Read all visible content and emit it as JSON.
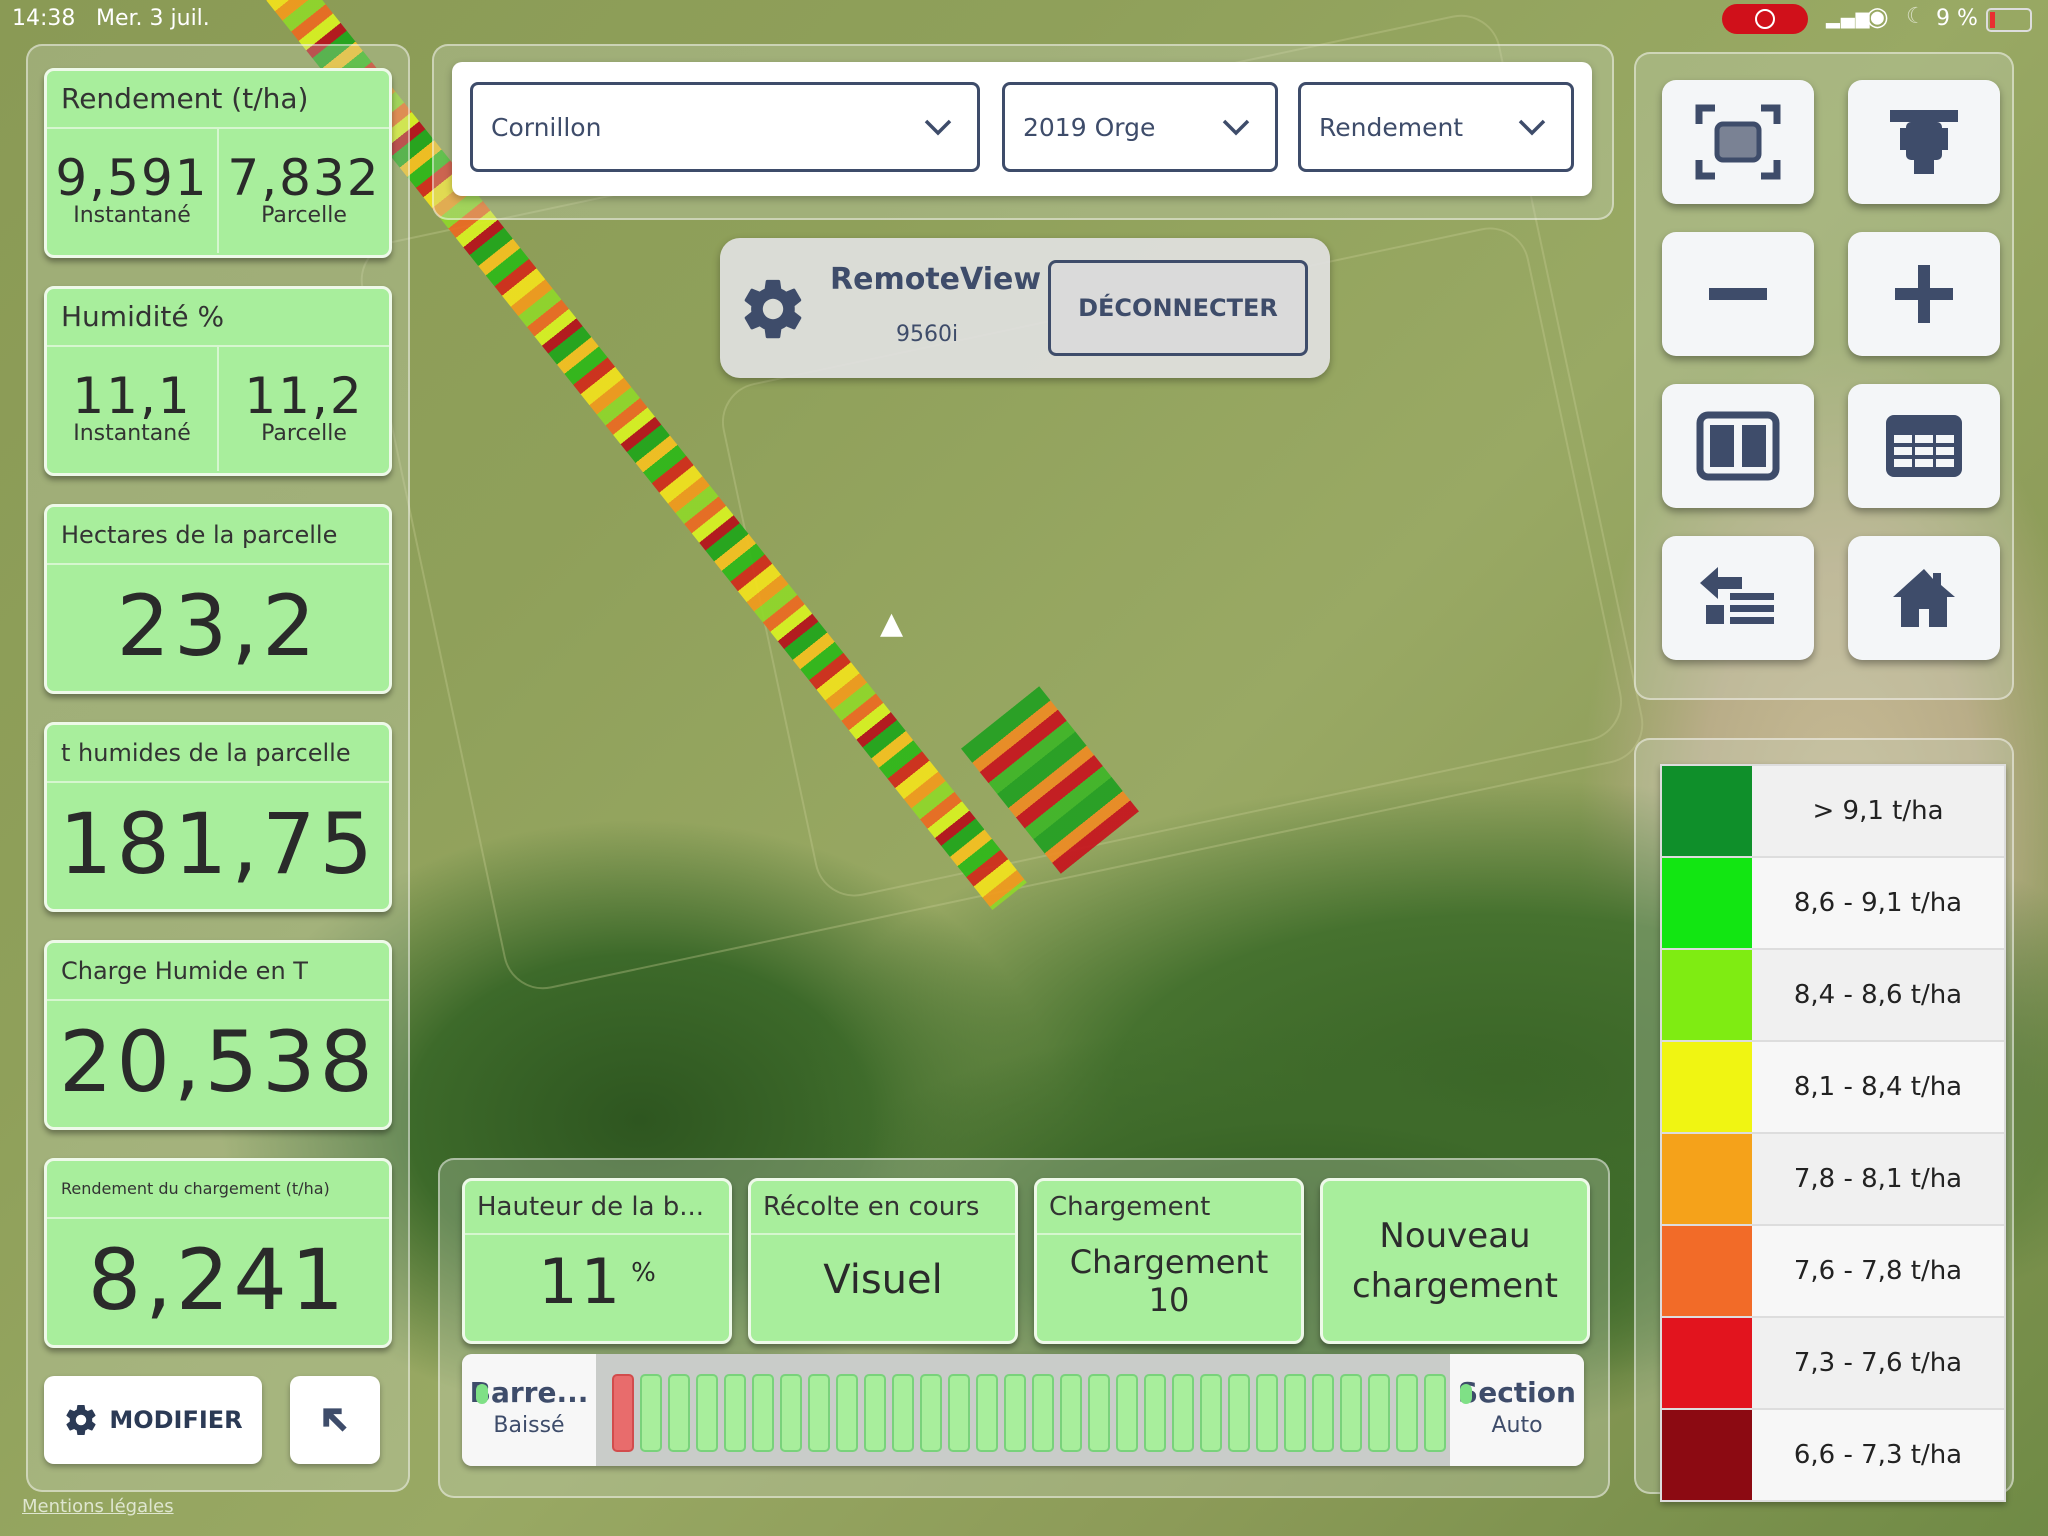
{
  "status_bar": {
    "time": "14:38",
    "date": "Mer. 3 juil.",
    "battery": "9 %"
  },
  "metrics": [
    {
      "title": "Rendement (t/ha)",
      "left_value": "9,591",
      "left_label": "Instantané",
      "right_value": "7,832",
      "right_label": "Parcelle"
    },
    {
      "title": "Humidité %",
      "left_value": "11,1",
      "left_label": "Instantané",
      "right_value": "11,2",
      "right_label": "Parcelle"
    }
  ],
  "single_metrics": [
    {
      "title": "Hectares de la parcelle",
      "value": "23,2"
    },
    {
      "title": "t humides de la parcelle",
      "value": "181,75"
    },
    {
      "title": "Charge Humide en T",
      "value": "20,538"
    },
    {
      "title": "Rendement du chargement (t/ha)",
      "value": "8,241"
    }
  ],
  "buttons": {
    "modifier": "MODIFIER",
    "legal": "Mentions légales"
  },
  "dropdowns": {
    "field": "Cornillon",
    "crop": "2019 Orge",
    "layer": "Rendement"
  },
  "remote_view": {
    "name": "RemoteView",
    "model": "9560i",
    "disconnect": "DÉCONNECTER"
  },
  "legend": [
    {
      "label": "> 9,1 t/ha",
      "color": "#0f8f2a"
    },
    {
      "label": "8,6 - 9,1 t/ha",
      "color": "#12e612"
    },
    {
      "label": "8,4 - 8,6 t/ha",
      "color": "#7fec12"
    },
    {
      "label": "8,1 - 8,4 t/ha",
      "color": "#f0f512"
    },
    {
      "label": "7,8 - 8,1 t/ha",
      "color": "#f5a21a"
    },
    {
      "label": "7,6 - 7,8 t/ha",
      "color": "#f26b28"
    },
    {
      "label": "7,3 - 7,6 t/ha",
      "color": "#e2141e"
    },
    {
      "label": "6,6 - 7,3 t/ha",
      "color": "#8c0a12"
    }
  ],
  "bottom_cards": {
    "height": {
      "title": "Hauteur de la b...",
      "value": "11",
      "unit": "%"
    },
    "harvest": {
      "title": "Récolte en cours",
      "value": "Visuel"
    },
    "load": {
      "title": "Chargement",
      "line1": "Chargement",
      "line2": "10"
    },
    "new_load": {
      "line1": "Nouveau",
      "line2": "chargement"
    }
  },
  "section_bar": {
    "left_head": "Barre...",
    "left_sub": "Baissé",
    "right_head": "Section",
    "right_sub": "Auto",
    "segment_count": 32,
    "active_red_index": 0
  }
}
